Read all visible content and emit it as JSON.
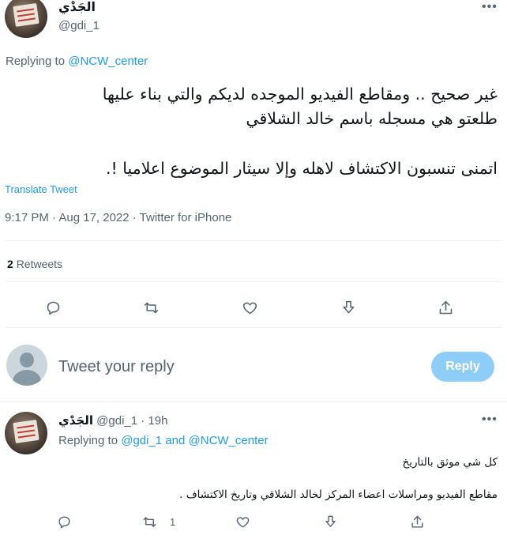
{
  "main_tweet": {
    "author_name": "الجَدْي",
    "author_handle": "@gdi_1",
    "replying_prefix": "Replying to",
    "replying_to": "@NCW_center",
    "text_line1": "غير صحيح .. ومقاطع الفيديو الموجده لديكم والتي بناء عليها",
    "text_line2": "طلعتو هي مسجله باسم خالد الشلاقي",
    "text_line3": "اتمنى تنسبون الاكتشاف لاهله وإلا سيثار الموضوع اعلاميا !.",
    "translate": "Translate Tweet",
    "timestamp": "9:17 PM · Aug 17, 2022 · Twitter for iPhone",
    "retweet_count": "2",
    "retweet_label": "Retweets"
  },
  "reply_box": {
    "placeholder": "Tweet your reply",
    "button_label": "Reply"
  },
  "reply_tweet": {
    "author_name": "الجَدْي",
    "handle_time": "@gdi_1 · 19h",
    "replying_prefix": "Replying to",
    "replying_to_1": "@gdi_1",
    "replying_and": "and",
    "replying_to_2": "@NCW_center",
    "text_line1": "كل شي موثق بالتاريخ",
    "text_line2": "مقاطع الفيديو ومراسلات اعضاء المركز لخالد الشلاقي وتاريخ الاكتشاف .",
    "retweet_count": "1"
  },
  "icons": {
    "more": "more-icon",
    "reply": "reply-icon",
    "retweet": "retweet-icon",
    "like": "like-icon",
    "bookmark": "download-icon",
    "share": "share-icon"
  },
  "colors": {
    "accent": "#1d9bf0",
    "reply_button_disabled": "#8ecdf8",
    "muted": "#536471"
  }
}
